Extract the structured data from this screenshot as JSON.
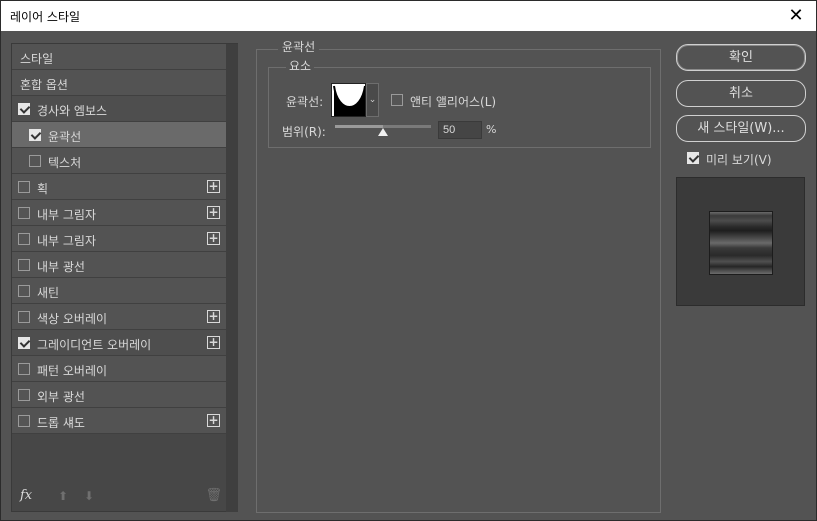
{
  "window": {
    "title": "레이어 스타일",
    "close_glyph": "✕"
  },
  "sidebar": {
    "items": [
      {
        "label": "스타일",
        "has_checkbox": false,
        "checked": false,
        "has_plus": false,
        "indent": false
      },
      {
        "label": "혼합 옵션",
        "has_checkbox": false,
        "checked": false,
        "has_plus": false,
        "indent": false
      },
      {
        "label": "경사와 엠보스",
        "has_checkbox": true,
        "checked": true,
        "has_plus": false,
        "indent": false
      },
      {
        "label": "윤곽선",
        "has_checkbox": true,
        "checked": true,
        "has_plus": false,
        "indent": true,
        "selected": true
      },
      {
        "label": "텍스처",
        "has_checkbox": true,
        "checked": false,
        "has_plus": false,
        "indent": true
      },
      {
        "label": "획",
        "has_checkbox": true,
        "checked": false,
        "has_plus": true,
        "indent": false
      },
      {
        "label": "내부 그림자",
        "has_checkbox": true,
        "checked": false,
        "has_plus": true,
        "indent": false
      },
      {
        "label": "내부 그림자",
        "has_checkbox": true,
        "checked": false,
        "has_plus": true,
        "indent": false
      },
      {
        "label": "내부 광선",
        "has_checkbox": true,
        "checked": false,
        "has_plus": false,
        "indent": false
      },
      {
        "label": "새틴",
        "has_checkbox": true,
        "checked": false,
        "has_plus": false,
        "indent": false
      },
      {
        "label": "색상 오버레이",
        "has_checkbox": true,
        "checked": false,
        "has_plus": true,
        "indent": false
      },
      {
        "label": "그레이디언트 오버레이",
        "has_checkbox": true,
        "checked": true,
        "has_plus": true,
        "indent": false
      },
      {
        "label": "패턴 오버레이",
        "has_checkbox": true,
        "checked": false,
        "has_plus": false,
        "indent": false
      },
      {
        "label": "외부 광선",
        "has_checkbox": true,
        "checked": false,
        "has_plus": false,
        "indent": false
      },
      {
        "label": "드롭 섀도",
        "has_checkbox": true,
        "checked": false,
        "has_plus": true,
        "indent": false
      }
    ],
    "footer": {
      "fx": "fx",
      "up": "⬆",
      "down": "⬇",
      "trash": "🗑"
    }
  },
  "contour_panel": {
    "group_title": "윤곽선",
    "elements_title": "요소",
    "contour_label": "윤곽선:",
    "anti_alias_label": "앤티 앨리어스(L)",
    "anti_alias_checked": false,
    "range_label": "범위(R):",
    "range_value": "50",
    "range_unit": "%",
    "range_fraction": 0.5
  },
  "buttons": {
    "ok": "확인",
    "cancel": "취소",
    "new_style": "새 스타일(W)..."
  },
  "preview": {
    "label": "미리 보기(V)",
    "checked": true
  }
}
